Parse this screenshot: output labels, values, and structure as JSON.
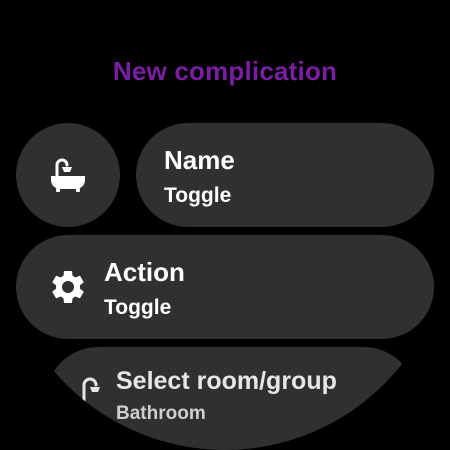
{
  "header": {
    "title": "New complication",
    "title_color": "#7b1fa2"
  },
  "items": {
    "icon_button": {
      "icon": "bathtub-shower-icon"
    },
    "name": {
      "label": "Name",
      "value": "Toggle"
    },
    "action": {
      "label": "Action",
      "value": "Toggle",
      "icon": "gear-icon"
    },
    "room": {
      "label": "Select room/group",
      "value": "Bathroom",
      "icon": "shower-icon"
    }
  },
  "colors": {
    "background": "#000000",
    "chip": "#303030",
    "text": "#ffffff"
  }
}
